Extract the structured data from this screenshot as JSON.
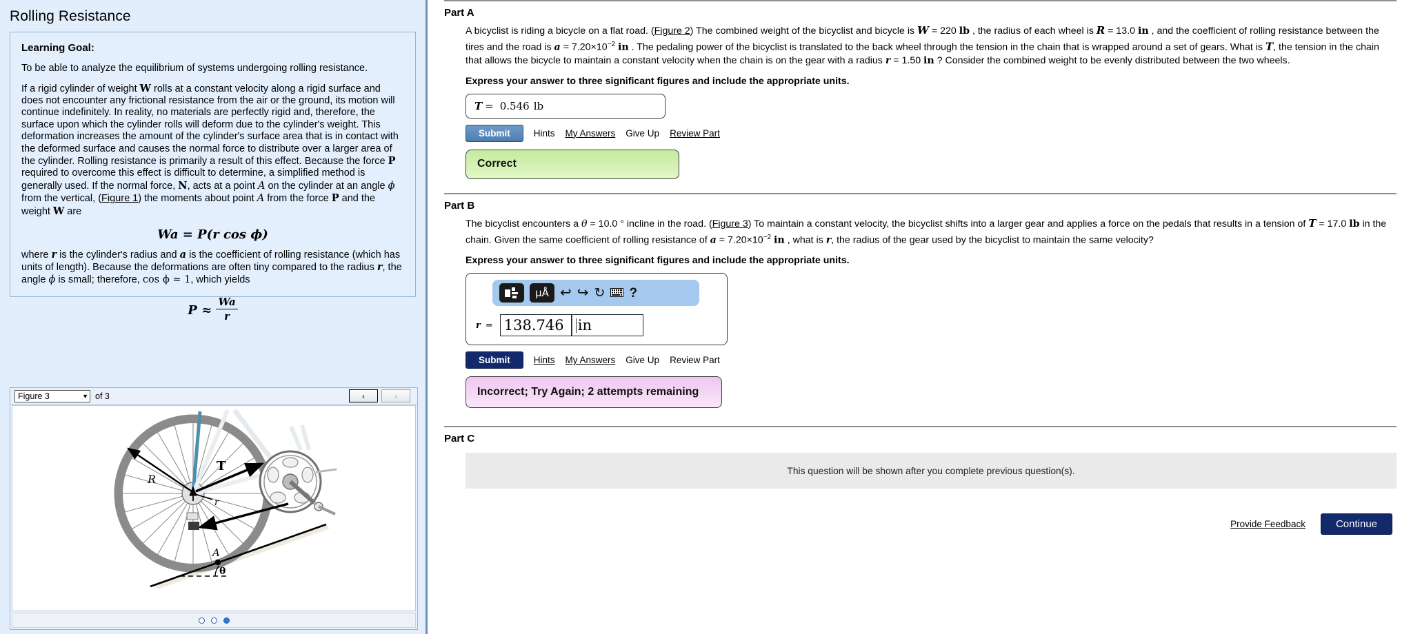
{
  "problem": {
    "title": "Rolling Resistance",
    "learning_goal_label": "Learning Goal:",
    "learning_goal_text": "To be able to analyze the equilibrium of systems undergoing rolling resistance.",
    "body_p1_a": "If a rigid cylinder of weight ",
    "body_W": "W",
    "body_p1_b": " rolls at a constant velocity along a rigid surface and does not encounter any frictional resistance from the air or the ground, its motion will continue indefinitely. In reality, no materials are perfectly rigid and, therefore, the surface upon which the cylinder rolls will deform due to the cylinder's weight. This deformation increases the amount of the cylinder's surface area that is in contact with the deformed surface and causes the normal force to distribute over a larger area of the cylinder. Rolling resistance is primarily a result of this effect. Because the force ",
    "body_P": "P",
    "body_p1_c": " required to overcome this effect is difficult to determine, a simplified method is generally used. If the normal force, ",
    "body_N": "N",
    "body_p1_d": ", acts at a point ",
    "body_A": "A",
    "body_p1_e": " on the cylinder at an angle ",
    "body_phi": "ϕ",
    "body_p1_f": " from the vertical, (",
    "figure1_link": "Figure 1",
    "body_p1_g": ") the moments about point ",
    "body_A2": "A",
    "body_p1_h": " from the force ",
    "body_P2": "P",
    "body_p1_i": " and the weight ",
    "body_W2": "W",
    "body_p1_j": " are",
    "equation1": "Wa = P(r cos ϕ)",
    "body_p2_a": "where ",
    "body_r": "r",
    "body_p2_b": " is the cylinder's radius and ",
    "body_a": "a",
    "body_p2_c": " is the coefficient of rolling resistance (which has units of length). Because the deformations are often tiny compared to the radius ",
    "body_r2": "r",
    "body_p2_d": ", the angle ",
    "body_phi2": "ϕ",
    "body_p2_e": " is small; therefore, ",
    "body_cos": "cos ϕ ≈ 1",
    "body_p2_f": ", which yields",
    "equation2_lhs": "P ≈",
    "equation2_num": "Wa",
    "equation2_den": "r"
  },
  "figure_widget": {
    "selected_figure": "Figure 3",
    "count_label": "of 3",
    "prev_label": "‹",
    "next_label": "›",
    "dots": [
      "Figure 1",
      "Figure 2",
      "Figure 3"
    ],
    "active_dot_index": 2,
    "figure_labels": {
      "tension": "T",
      "wheel_radius": "R",
      "gear_radius": "r",
      "contact_point": "A",
      "incline_angle": "θ"
    }
  },
  "partA": {
    "label": "Part A",
    "q_a": "A bicyclist is riding a bicycle on a flat road. (",
    "figure2_link": "Figure 2",
    "q_b": ") The combined weight of the bicyclist and bicycle is ",
    "sym_W": "W",
    "val_W": " = 220 ",
    "unit_lb": "lb",
    "q_c": " , the radius of each wheel is ",
    "sym_R": "R",
    "val_R": " = 13.0 ",
    "unit_in": "in",
    "q_d": " , and the coefficient of rolling resistance between the tires and the road is ",
    "sym_a": "a",
    "val_a": " = 7.20×10",
    "exp_a": "−2",
    "unit_in2": "in",
    "q_e": " . The pedaling power of the bicyclist is translated to the back wheel through the tension in the chain that is wrapped around a set of gears. What is ",
    "sym_T": "T",
    "q_f": ", the tension in the chain that allows the bicycle to maintain a constant velocity when the chain is on the gear with a radius ",
    "sym_r": "r",
    "val_r": " = 1.50 ",
    "unit_in3": "in",
    "q_g": " ? Consider the combined weight to be evenly distributed between the two wheels.",
    "instruction": "Express your answer to three significant figures and include the appropriate units.",
    "answer_symbol": "T",
    "answer_equals": "=",
    "answer_value": "0.546",
    "answer_unit": "lb",
    "submit_label": "Submit",
    "hints_label": "Hints",
    "my_answers_label": "My Answers",
    "give_up_label": "Give Up",
    "review_part_label": "Review Part",
    "feedback": "Correct"
  },
  "partB": {
    "label": "Part B",
    "q_a": "The bicyclist encounters a ",
    "sym_theta": "θ",
    "val_theta": " = 10.0 °",
    "q_b": " incline in the road. (",
    "figure3_link": "Figure 3",
    "q_c": ") To maintain a constant velocity, the bicyclist shifts into a larger gear and applies a force on the pedals that results in a tension of ",
    "sym_T": "T",
    "val_T": " = 17.0 ",
    "unit_lb": "lb",
    "q_d": " in the chain. Given the same coefficient of rolling resistance of ",
    "sym_a": "a",
    "val_a": " = 7.20×10",
    "exp_a": "−2",
    "unit_in": "in",
    "q_e": " , what is ",
    "sym_r": "r",
    "q_f": ", the radius of the gear used by the bicyclist to maintain the same velocity?",
    "instruction": "Express your answer to three significant figures and include the appropriate units.",
    "toolbar": {
      "template_icon": "math-template-icon",
      "units_icon": "μÅ",
      "undo_icon": "←",
      "redo_icon": "→",
      "reset_icon": "↻",
      "keyboard_icon": "keyboard-icon",
      "help_icon": "?"
    },
    "answer_symbol": "r",
    "answer_equals": "=",
    "answer_value": "138.746",
    "answer_unit": "in",
    "submit_label": "Submit",
    "hints_label": "Hints",
    "my_answers_label": "My Answers",
    "give_up_label": "Give Up",
    "review_part_label": "Review Part",
    "feedback": "Incorrect; Try Again; 2 attempts remaining"
  },
  "partC": {
    "label": "Part C",
    "notice": "This question will be shown after you complete previous question(s)."
  },
  "footer": {
    "feedback_link": "Provide Feedback",
    "continue_label": "Continue"
  },
  "colors": {
    "panel_bg": "#e2eefc",
    "correct_green": "#c3eb9d",
    "incorrect_pink": "#eec6f0",
    "submit_blue": "#12296b",
    "toolbar_blue": "#a5c8ee"
  }
}
